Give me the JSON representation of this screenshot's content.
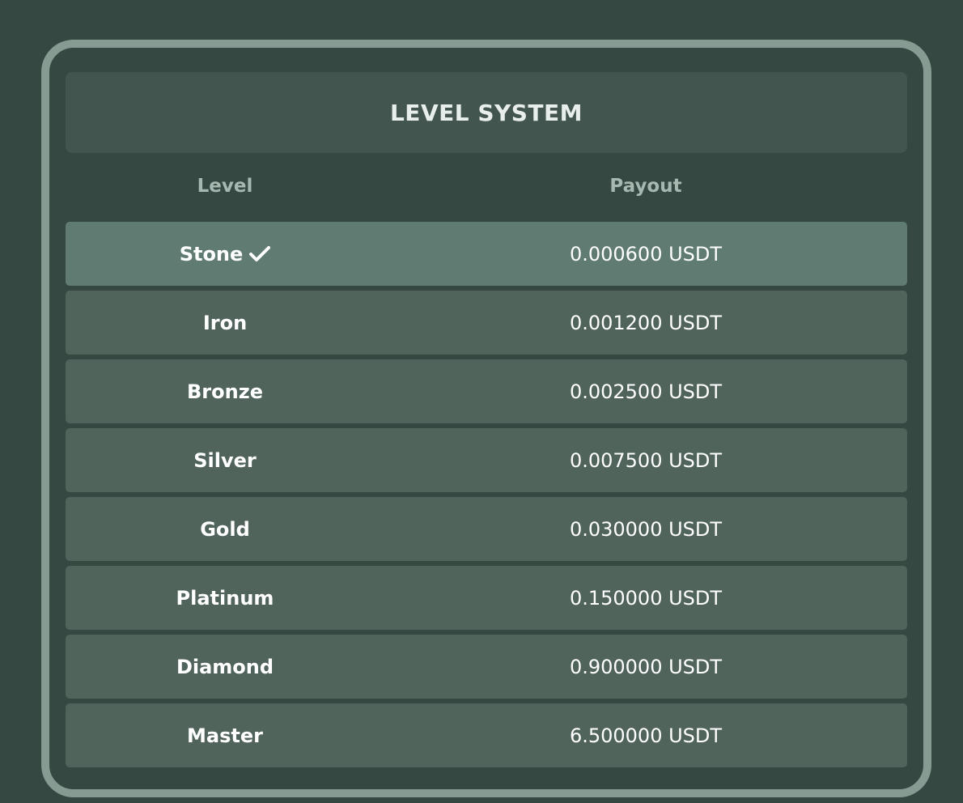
{
  "header": {
    "title": "LEVEL SYSTEM"
  },
  "columns": {
    "level": "Level",
    "payout": "Payout"
  },
  "rows": [
    {
      "level": "Stone",
      "payout": "0.000600 USDT",
      "current": true
    },
    {
      "level": "Iron",
      "payout": "0.001200 USDT",
      "current": false
    },
    {
      "level": "Bronze",
      "payout": "0.002500 USDT",
      "current": false
    },
    {
      "level": "Silver",
      "payout": "0.007500 USDT",
      "current": false
    },
    {
      "level": "Gold",
      "payout": "0.030000 USDT",
      "current": false
    },
    {
      "level": "Platinum",
      "payout": "0.150000 USDT",
      "current": false
    },
    {
      "level": "Diamond",
      "payout": "0.900000 USDT",
      "current": false
    },
    {
      "level": "Master",
      "payout": "6.500000 USDT",
      "current": false
    }
  ],
  "icons": {
    "current_marker": "check-icon"
  },
  "colors": {
    "background": "#354842",
    "panel_border": "#869b92",
    "header_bg": "#42554f",
    "row_bg": "#50645c",
    "active_row_bg": "#5f7b72",
    "column_header_text": "#a7b8b1",
    "text": "#ffffff"
  }
}
